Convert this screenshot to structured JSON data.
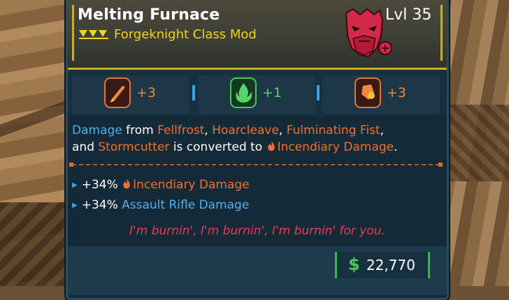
{
  "item": {
    "name": "Melting Furnace",
    "type": "Forgeknight Class Mod",
    "level": "Lvl 35"
  },
  "skills": [
    {
      "icon": "rocket-skill-icon",
      "count": "+3",
      "color": "#f08a3a"
    },
    {
      "icon": "green-flame-skill-icon",
      "count": "+1",
      "color": "#56d66a"
    },
    {
      "icon": "shield-skill-icon",
      "count": "+3",
      "color": "#f08a3a"
    }
  ],
  "description": {
    "part1": "Damage",
    "part2": " from ",
    "part3": "Fellfrost",
    "part4": ", ",
    "part5": "Hoarcleave",
    "part6": ", ",
    "part7": "Fulminating Fist",
    "part8": ",",
    "part9": "and ",
    "part10": "Stormcutter",
    "part11": " is converted to ",
    "part12": "Incendiary Damage",
    "part13": "."
  },
  "stats": [
    {
      "value": "+34%",
      "label": "Incendiary Damage"
    },
    {
      "value": "+34%",
      "label": "Assault Rifle Damage"
    }
  ],
  "flavor": "I'm burnin', I'm burnin', I'm burnin' for you.",
  "price": {
    "currency": "$",
    "amount": "22,770"
  },
  "colors": {
    "rarity": "#f2d41c",
    "keyword_blue": "#55b0ee",
    "keyword_orange": "#f07030",
    "flavor": "#ef3a4e",
    "money": "#4fc55a"
  }
}
